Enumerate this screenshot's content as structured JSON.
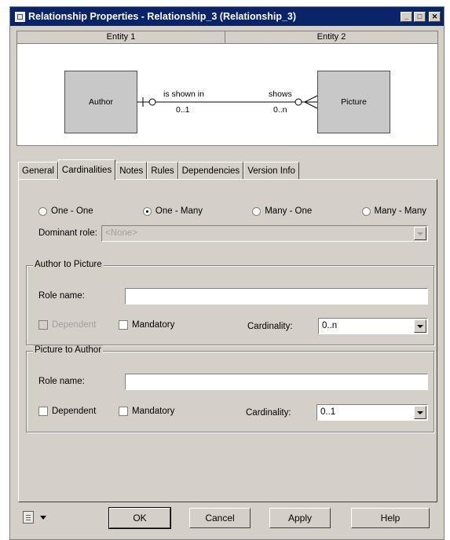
{
  "window": {
    "title": "Relationship Properties - Relationship_3 (Relationship_3)",
    "minimize": "_",
    "maximize": "□",
    "close": "✕"
  },
  "diagram": {
    "entity1_header": "Entity 1",
    "entity2_header": "Entity 2",
    "entity1": "Author",
    "entity2": "Picture",
    "role_left": "is shown in",
    "card_left": "0..1",
    "role_right": "shows",
    "card_right": "0..n"
  },
  "tabs": [
    "General",
    "Cardinalities",
    "Notes",
    "Rules",
    "Dependencies",
    "Version Info"
  ],
  "active_tab": "Cardinalities",
  "cardinality_options": [
    {
      "label": "One - One",
      "selected": false
    },
    {
      "label": "One - Many",
      "selected": true
    },
    {
      "label": "Many - One",
      "selected": false
    },
    {
      "label": "Many - Many",
      "selected": false
    }
  ],
  "dominant_role": {
    "label": "Dominant role:",
    "value": "<None>"
  },
  "group1": {
    "title": "Author to Picture",
    "role_label": "Role name:",
    "role_value": "",
    "dependent": "Dependent",
    "mandatory": "Mandatory",
    "cardinality_label": "Cardinality:",
    "cardinality_value": "0..n"
  },
  "group2": {
    "title": "Picture to Author",
    "role_label": "Role name:",
    "role_value": "",
    "dependent": "Dependent",
    "mandatory": "Mandatory",
    "cardinality_label": "Cardinality:",
    "cardinality_value": "0..1"
  },
  "buttons": {
    "ok": "OK",
    "cancel": "Cancel",
    "apply": "Apply",
    "help": "Help"
  }
}
